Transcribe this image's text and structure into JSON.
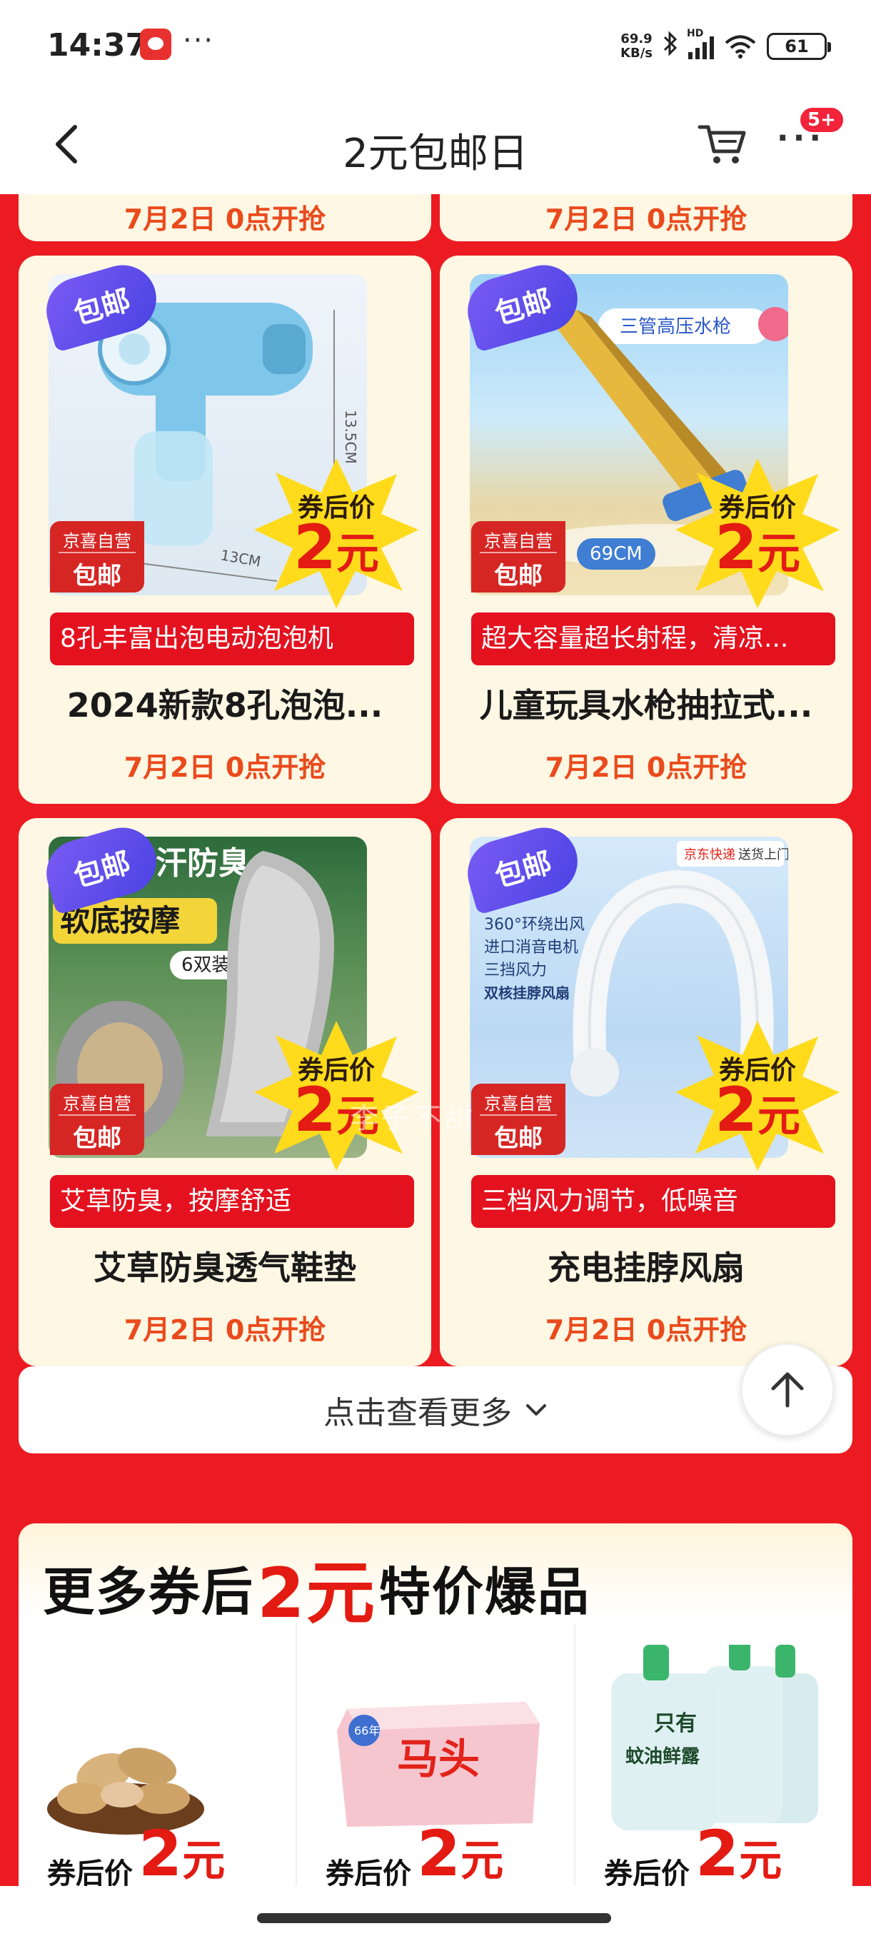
{
  "status_bar": {
    "time": "14:37",
    "dots": "···",
    "net_speed_value": "69.9",
    "net_speed_unit": "KB/s",
    "network_type": "HD",
    "battery": "61"
  },
  "header": {
    "title": "2元包邮日",
    "message_badge": "5+"
  },
  "prev_row": {
    "left_date": "7月2日 0点开抢",
    "right_date": "7月2日 0点开抢"
  },
  "products": [
    {
      "image_icon": "bubble-gun-image",
      "postage_tag": "包邮",
      "jd_badge_line1": "京喜自营",
      "jd_badge_line2": "包邮",
      "price_label": "券后价",
      "price_value": "2",
      "price_unit": "元",
      "sub_tag": "8孔丰富出泡电动泡泡机",
      "name": "2024新款8孔泡泡...",
      "date": "7月2日 0点开抢",
      "image_text": "13.5CM",
      "image_text2": "13CM"
    },
    {
      "image_icon": "water-gun-image",
      "postage_tag": "包邮",
      "jd_badge_line1": "京喜自营",
      "jd_badge_line2": "包邮",
      "price_label": "券后价",
      "price_value": "2",
      "price_unit": "元",
      "sub_tag": "超大容量超长射程，清凉...",
      "name": "儿童玩具水枪抽拉式...",
      "date": "7月2日 0点开抢",
      "image_text": "三管高压水枪",
      "image_text2": "69CM"
    },
    {
      "image_icon": "insole-image",
      "postage_tag": "包邮",
      "jd_badge_line1": "京喜自营",
      "jd_badge_line2": "包邮",
      "price_label": "券后价",
      "price_value": "2",
      "price_unit": "元",
      "sub_tag": "艾草防臭，按摩舒适",
      "name": "艾草防臭透气鞋垫",
      "date": "7月2日 0点开抢",
      "image_text": "汗防臭",
      "image_text2": "软底按摩",
      "image_text3": "6双装"
    },
    {
      "image_icon": "neck-fan-image",
      "postage_tag": "包邮",
      "jd_badge_line1": "京喜自营",
      "jd_badge_line2": "包邮",
      "price_label": "券后价",
      "price_value": "2",
      "price_unit": "元",
      "sub_tag": "三档风力调节，低噪音",
      "name": "充电挂脖风扇",
      "date": "7月2日 0点开抢",
      "image_text": "京东快递",
      "image_text2": "送货上门",
      "image_features": [
        "360°环绕出风",
        "进口消音电机",
        "三挡风力",
        "双核挂脖风扇"
      ]
    }
  ],
  "watermark": "李子不甜",
  "load_more": "点击查看更多",
  "hot_section": {
    "title_pre": "更多券后",
    "title_highlight": "2元",
    "title_post": "特价爆品",
    "items": [
      {
        "image_icon": "peanuts-image",
        "price_label": "券后价",
        "price_value": "2",
        "price_unit": "元"
      },
      {
        "image_icon": "soap-powder-image",
        "price_label": "券后价",
        "price_value": "2",
        "price_unit": "元",
        "image_text": "马头",
        "image_text2": "66年"
      },
      {
        "image_icon": "cooling-gel-image",
        "price_label": "券后价",
        "price_value": "2",
        "price_unit": "元",
        "image_text": "只有",
        "image_text2": "蚊油鲜露"
      }
    ]
  },
  "colors": {
    "brand_red": "#ec1b22",
    "price_red": "#e31b13",
    "date_orange": "#ea4a1c",
    "card_bg": "#fdf7e4",
    "postage_purple": "#5a48ea",
    "burst_yellow": "#ffdb1c"
  }
}
